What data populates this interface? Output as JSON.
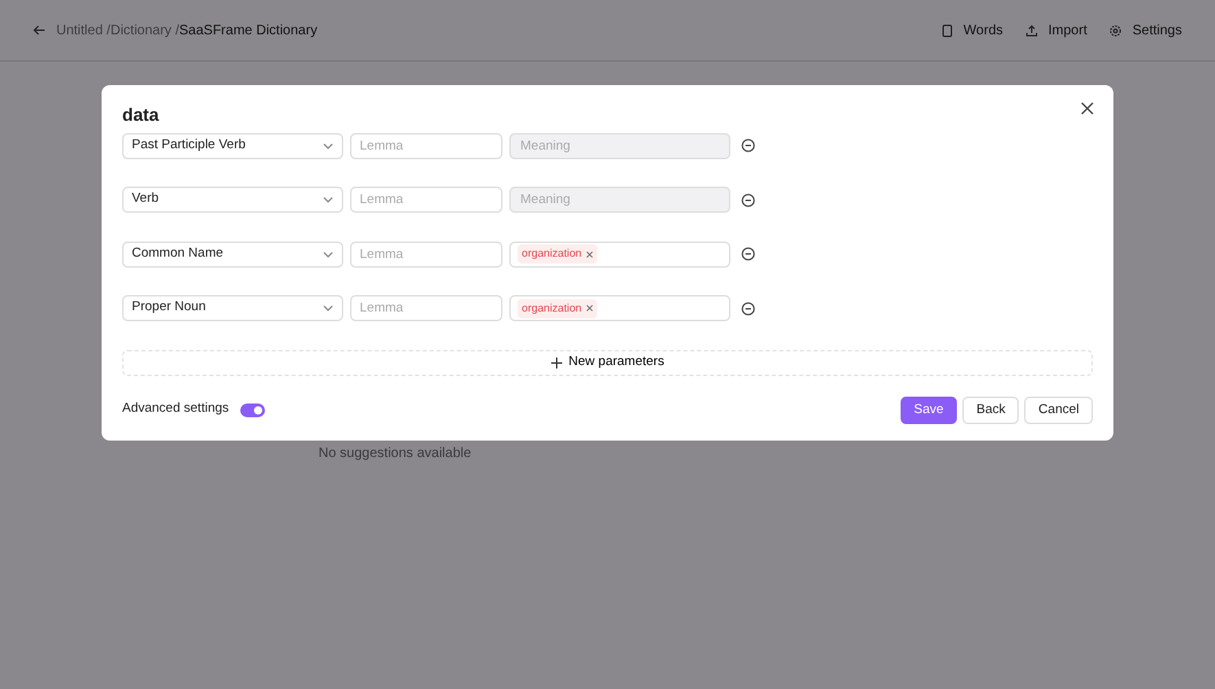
{
  "header": {
    "breadcrumb": [
      {
        "label": "Untitled /",
        "current": false
      },
      {
        "label": "Dictionary /",
        "current": false
      },
      {
        "label": "SaaSFrame Dictionary",
        "current": true
      }
    ],
    "nav": [
      {
        "label": "Words"
      },
      {
        "label": "Import"
      },
      {
        "label": "Settings"
      }
    ]
  },
  "background_text": "No suggestions available",
  "modal": {
    "title": "data",
    "rows": [
      {
        "type": "Past Participle Verb",
        "lemma_placeholder": "Lemma",
        "meaning": {
          "kind": "disabled",
          "placeholder": "Meaning"
        }
      },
      {
        "type": "Verb",
        "lemma_placeholder": "Lemma",
        "meaning": {
          "kind": "disabled",
          "placeholder": "Meaning"
        }
      },
      {
        "type": "Common Name",
        "lemma_placeholder": "Lemma",
        "meaning": {
          "kind": "tags",
          "tags": [
            "organization"
          ]
        }
      },
      {
        "type": "Proper Noun",
        "lemma_placeholder": "Lemma",
        "meaning": {
          "kind": "tags",
          "tags": [
            "organization"
          ]
        }
      }
    ],
    "add_button": "New parameters",
    "advanced": {
      "label": "Advanced settings",
      "on": true
    },
    "buttons": [
      {
        "label": "Save",
        "kind": "primary"
      },
      {
        "label": "Back",
        "kind": "secondary"
      },
      {
        "label": "Cancel",
        "kind": "secondary"
      }
    ]
  }
}
